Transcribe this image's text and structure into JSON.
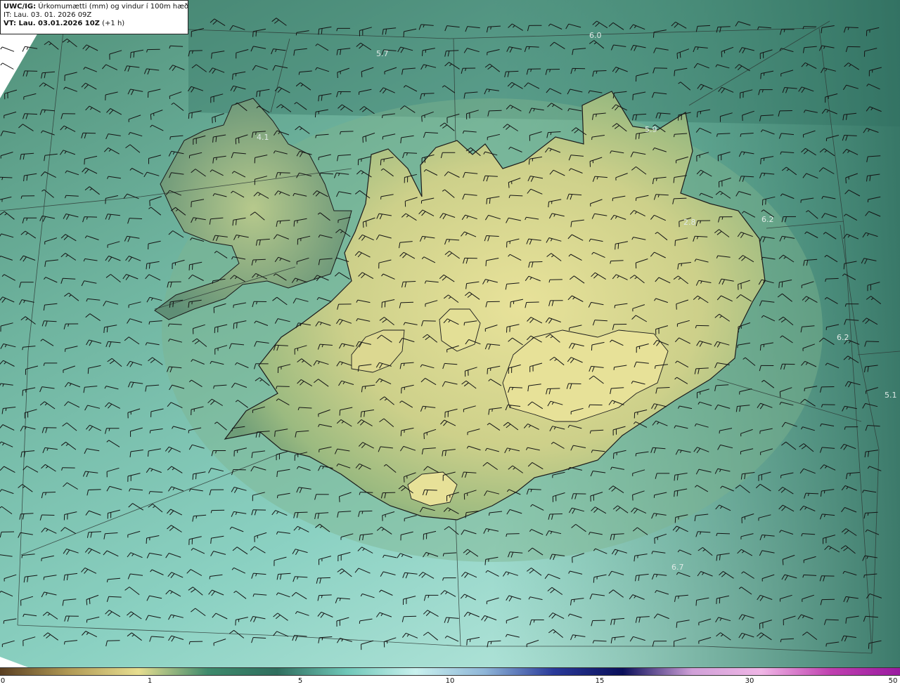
{
  "header": {
    "model": "UWC/IG:",
    "title": "Úrkomumætti (mm) og vindur í 100m hæð",
    "it_line": "IT: Lau. 03. 01. 2026 09Z",
    "vt_label": "VT: Lau. 03.01.2026 10Z",
    "vt_suffix": " (+1 h)"
  },
  "map_values": [
    "6.0",
    "5.7",
    "5.9",
    "4.1",
    "2.8",
    "6.2",
    "6.2",
    "5.1",
    "6.7"
  ],
  "colorbar": {
    "tick_labels": [
      "0",
      "1",
      "5",
      "10",
      "15",
      "30",
      "50"
    ],
    "colors": [
      "#5a3f22",
      "#b19a55",
      "#e7de90",
      "#3e8a6c",
      "#2f6e5e",
      "#6fc7b8",
      "#c9f1ee",
      "#8fb6d8",
      "#2a3a9a",
      "#0a0f5a",
      "#d0a0d8",
      "#f0b6e6",
      "#c040b0",
      "#9a1aa0"
    ]
  },
  "colors": {
    "sea_light": "#8bd1c2",
    "sea_mid": "#4c9a82",
    "sea_dark": "#2f6e5e",
    "land_low": "#7fa777",
    "land_high": "#e5e098"
  }
}
